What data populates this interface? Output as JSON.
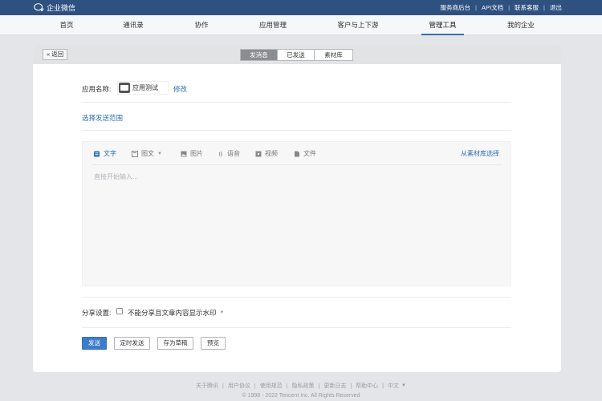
{
  "topbar": {
    "logo_text": "企业微信",
    "links": [
      "服务商后台",
      "API文档",
      "联系客服",
      "退出"
    ]
  },
  "nav": {
    "items": [
      "首页",
      "通讯录",
      "协作",
      "应用管理",
      "客户与上下游",
      "管理工具",
      "我的企业"
    ],
    "active_index": 5
  },
  "subbar": {
    "back_label": "« 返回",
    "segments": [
      "发消息",
      "已发送",
      "素材库"
    ],
    "active_segment": 0
  },
  "form": {
    "app_name_label": "应用名称:",
    "app_name_value": "应用测试",
    "modify_link": "修改",
    "scope_link": "选择发送范围",
    "editor": {
      "tools": [
        "文字",
        "图文",
        "图片",
        "语音",
        "视频",
        "文件"
      ],
      "active_tool": 0,
      "material_link": "从素材库选择",
      "placeholder": "直接开始输入..."
    },
    "share_label": "分享设置:",
    "share_option": "不能分享且文章内容显示水印"
  },
  "actions": {
    "send": "发送",
    "schedule": "定时发送",
    "draft": "存为草稿",
    "preview": "预览"
  },
  "footer": {
    "links": [
      "关于腾讯",
      "用户协议",
      "使用规范",
      "隐私政策",
      "更新日志",
      "帮助中心",
      "中文"
    ],
    "copyright": "© 1998 - 2022 Tencent Inc. All Rights Reserved"
  },
  "colors": {
    "topbar": "#2e5180",
    "accent": "#3d7ccb",
    "link": "#2e6fb0"
  }
}
